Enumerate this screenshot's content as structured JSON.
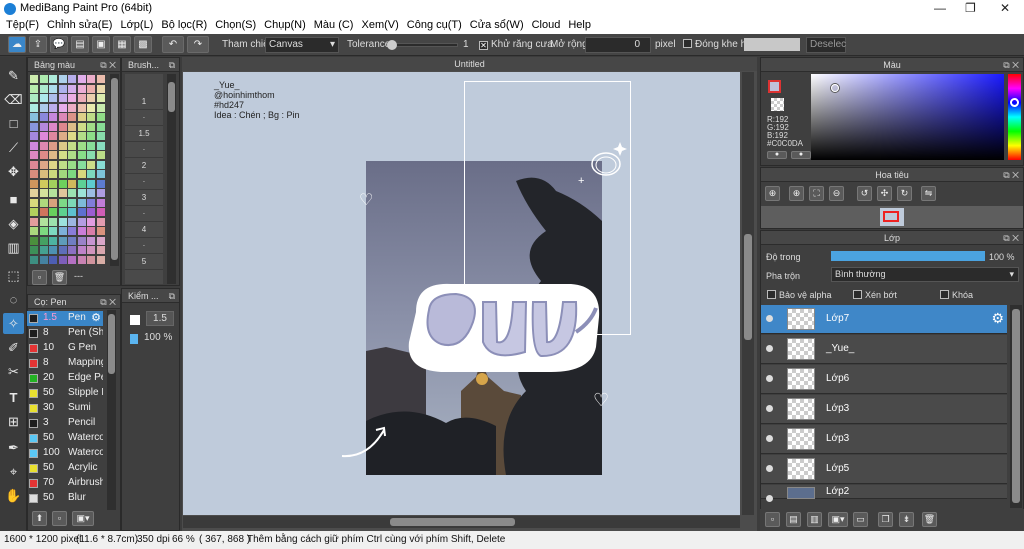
{
  "window": {
    "title": "MediBang Paint Pro (64bit)",
    "min": "—",
    "max": "❐",
    "close": "✕"
  },
  "menu": [
    "Tệp(F)",
    "Chỉnh sửa(E)",
    "Lớp(L)",
    "Bộ lọc(R)",
    "Chọn(S)",
    "Chụp(N)",
    "Màu (C)",
    "Xem(V)",
    "Công cụ(T)",
    "Cửa sổ(W)",
    "Cloud",
    "Help"
  ],
  "toolbar": {
    "ref_label": "Tham chiếu",
    "ref_value": "Canvas",
    "tolerance_label": "Tolerance",
    "tolerance_value": "1",
    "antialias_label": "Khử răng cưa",
    "antialias_checked": "✕",
    "expand_label": "Mở rộng",
    "expand_value": "0",
    "expand_unit": "pixel",
    "gap_label": "Đóng khe hở",
    "deselect_label": "Deselec"
  },
  "palette_panel": {
    "title": "Bảng màu"
  },
  "brushsize_panel": {
    "title": "Brush...",
    "sizes": [
      "1",
      "·",
      "1.5",
      "·",
      "2",
      "·",
      "3",
      "·",
      "4",
      "·",
      "5"
    ]
  },
  "brush_panel": {
    "title": "Cọ: Pen",
    "brushes": [
      {
        "size": "1.5",
        "name": "Pen",
        "color": "#1e1e1e",
        "selected": true
      },
      {
        "size": "8",
        "name": "Pen (Sha",
        "color": "#1e1e1e"
      },
      {
        "size": "10",
        "name": "G Pen",
        "color": "#e53434"
      },
      {
        "size": "8",
        "name": "Mapping",
        "color": "#e53434"
      },
      {
        "size": "20",
        "name": "Edge Pe",
        "color": "#23b223"
      },
      {
        "size": "50",
        "name": "Stipple P",
        "color": "#e8e030"
      },
      {
        "size": "30",
        "name": "Sumi",
        "color": "#e8e030"
      },
      {
        "size": "3",
        "name": "Pencil",
        "color": "#1e1e1e"
      },
      {
        "size": "50",
        "name": "Waterco",
        "color": "#5bc8f5"
      },
      {
        "size": "100",
        "name": "Waterco",
        "color": "#5bc8f5"
      },
      {
        "size": "50",
        "name": "Acrylic",
        "color": "#e8e030"
      },
      {
        "size": "70",
        "name": "Airbrush",
        "color": "#e53434"
      },
      {
        "size": "50",
        "name": "Blur",
        "color": "#dddddd"
      }
    ]
  },
  "check_panel": {
    "title": "Kiểm ...",
    "size": "1.5",
    "opacity": "100 %"
  },
  "canvas": {
    "tab_title": "Untitled",
    "text_lines": [
      "_Yue_",
      "@hoinhimthom",
      "#hd247",
      "Idea : Chén ; Bg : Pin"
    ]
  },
  "color_panel": {
    "title": "Màu",
    "r": "R:192",
    "g": "G:192",
    "b": "B:192",
    "hex": "#C0C0DA",
    "main_color": "#c0c0da"
  },
  "nav_panel": {
    "title": "Hoa tiêu"
  },
  "layer_panel": {
    "title": "Lớp",
    "opacity_label": "Độ trong",
    "opacity_value": "100 %",
    "opacity_fraction": 1.0,
    "blend_label": "Pha trộn",
    "blend_value": "Bình thường",
    "protect_alpha": "Bảo vệ alpha",
    "clip": "Xén bớt",
    "lock": "Khóa",
    "layers": [
      {
        "name": "Lớp7",
        "selected": true
      },
      {
        "name": "_Yue_"
      },
      {
        "name": "Lớp6"
      },
      {
        "name": "Lớp3"
      },
      {
        "name": "Lớp3"
      },
      {
        "name": "Lớp5"
      },
      {
        "name": "Lớp2"
      }
    ]
  },
  "status": {
    "size": "1600 * 1200 pixel",
    "cm": "(11.6 * 8.7cm)",
    "dpi": "350 dpi",
    "zoom": "66 %",
    "coords": "( 367, 868 )",
    "hint": "Thêm bằng cách giữ phím Ctrl cùng với phím Shift, Delete"
  }
}
